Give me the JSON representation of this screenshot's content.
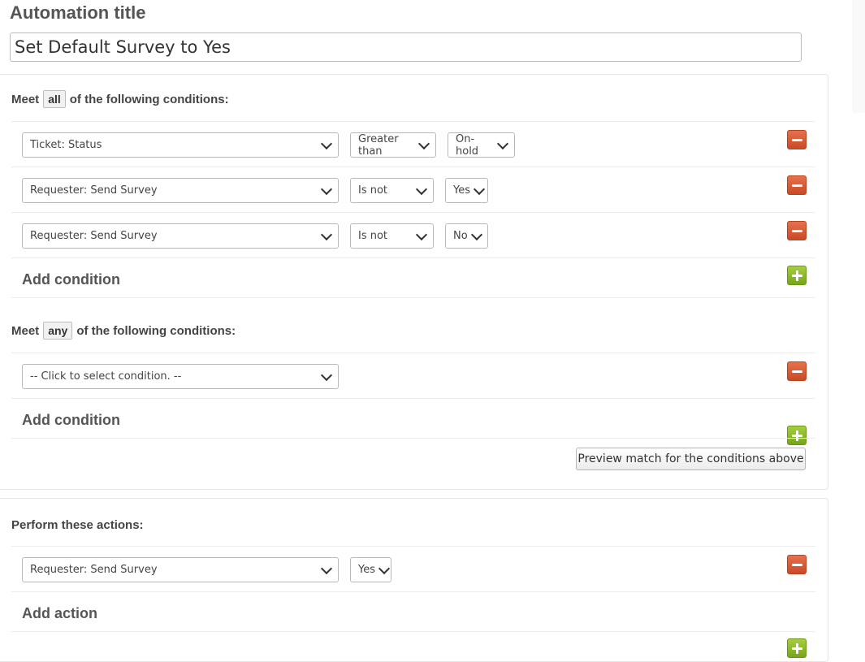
{
  "page": {
    "title": "Automation title",
    "title_value": "Set Default Survey to Yes"
  },
  "conditions_all": {
    "meet_prefix": "Meet",
    "mode": "all",
    "meet_suffix": "of the following conditions:",
    "rows": [
      {
        "field": "Ticket: Status",
        "operator": "Greater than",
        "value": "On-hold"
      },
      {
        "field": "Requester: Send Survey",
        "operator": "Is not",
        "value": "Yes"
      },
      {
        "field": "Requester: Send Survey",
        "operator": "Is not",
        "value": "No"
      }
    ],
    "add_label": "Add condition"
  },
  "conditions_any": {
    "meet_prefix": "Meet",
    "mode": "any",
    "meet_suffix": "of the following conditions:",
    "rows": [
      {
        "field": "-- Click to select condition. --"
      }
    ],
    "add_label": "Add condition",
    "preview_label": "Preview match for the conditions above"
  },
  "actions": {
    "heading": "Perform these actions:",
    "rows": [
      {
        "field": "Requester: Send Survey",
        "value": "Yes"
      }
    ],
    "add_label": "Add action"
  },
  "icons": {
    "remove": "minus-icon",
    "add": "plus-icon",
    "dropdown": "chevron-down-icon"
  },
  "colors": {
    "remove_button": "#d95a34",
    "add_button": "#8cbd2c",
    "text": "#555555"
  }
}
